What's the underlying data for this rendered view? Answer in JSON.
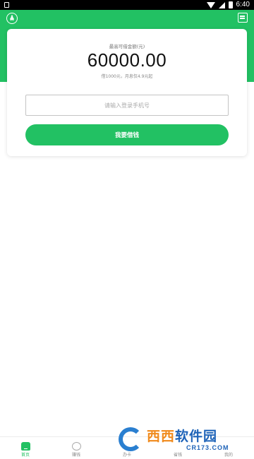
{
  "status_bar": {
    "time": "6:40"
  },
  "header": {
    "left_icon": "rocket-badge-icon",
    "right_icon": "message-icon",
    "accent_color": "#22c163"
  },
  "card": {
    "amount_label": "最高可借金额(元)",
    "amount": "60000.00",
    "amount_note": "借1000元，月息仅4.9元起",
    "phone_placeholder": "请输入登录手机号",
    "borrow_button": "我要借钱"
  },
  "bottom_nav": {
    "items": [
      {
        "label": "首页",
        "icon": "home-icon",
        "active": true
      },
      {
        "label": "赚钱",
        "icon": "coin-bag-icon",
        "active": false
      },
      {
        "label": "办卡",
        "icon": "card-icon",
        "active": false
      },
      {
        "label": "省钱",
        "icon": "save-icon",
        "active": false
      },
      {
        "label": "我的",
        "icon": "profile-icon",
        "active": false
      }
    ]
  },
  "watermark": {
    "brand_orange": "西西",
    "brand_blue": "软件园",
    "domain": "CR173.COM"
  }
}
